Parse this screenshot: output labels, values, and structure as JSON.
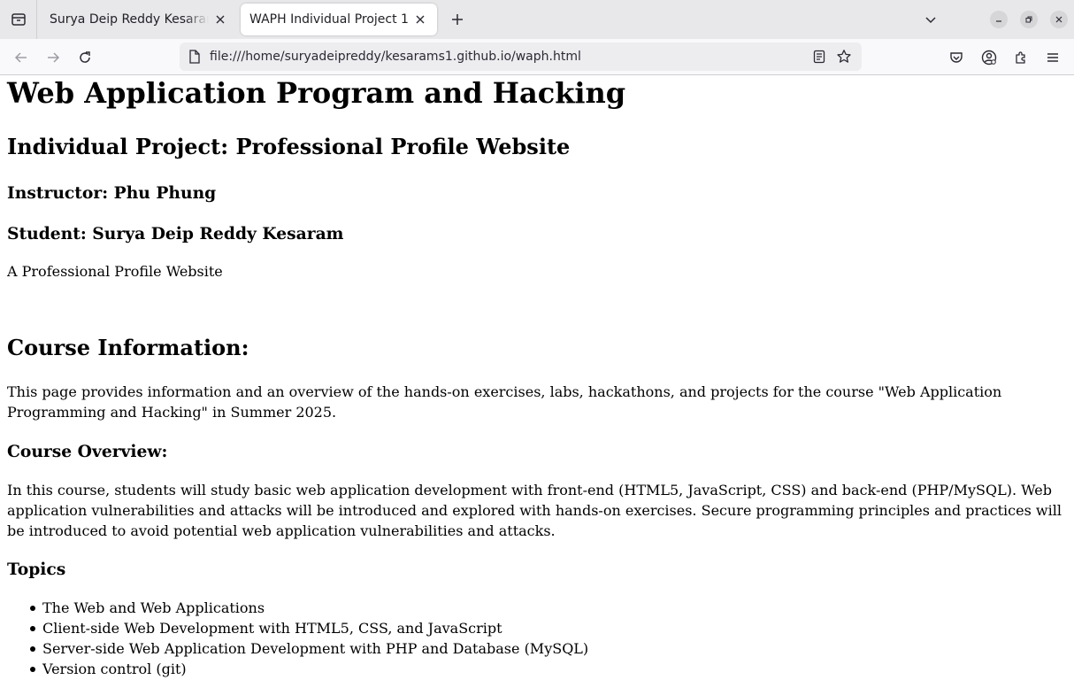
{
  "browser": {
    "tabs": [
      {
        "title": "Surya Deip Reddy Kesaram - ",
        "active": false
      },
      {
        "title": "WAPH Individual Project 1",
        "active": true
      }
    ],
    "url": "file:///home/suryadeipreddy/kesarams1.github.io/waph.html"
  },
  "page": {
    "title": "Web Application Program and Hacking",
    "subtitle": "Individual Project: Professional Profile Website",
    "instructor": "Instructor: Phu Phung",
    "student": "Student: Surya Deip Reddy Kesaram",
    "tagline": "A Professional Profile Website",
    "course_info_heading": "Course Information:",
    "course_info_text": "This page provides information and an overview of the hands-on exercises, labs, hackathons, and projects for the course \"Web Application Programming and Hacking\" in Summer 2025.",
    "overview_heading": "Course Overview:",
    "overview_text": "In this course, students will study basic web application development with front-end (HTML5, JavaScript, CSS) and back-end (PHP/MySQL). Web application vulnerabilities and attacks will be introduced and explored with hands-on exercises. Secure programming principles and practices will be introduced to avoid potential web application vulnerabilities and attacks.",
    "topics_heading": "Topics",
    "topics": [
      "The Web and Web Applications",
      "Client-side Web Development with HTML5, CSS, and JavaScript",
      "Server-side Web Application Development with PHP and Database (MySQL)",
      "Version control (git)"
    ]
  }
}
